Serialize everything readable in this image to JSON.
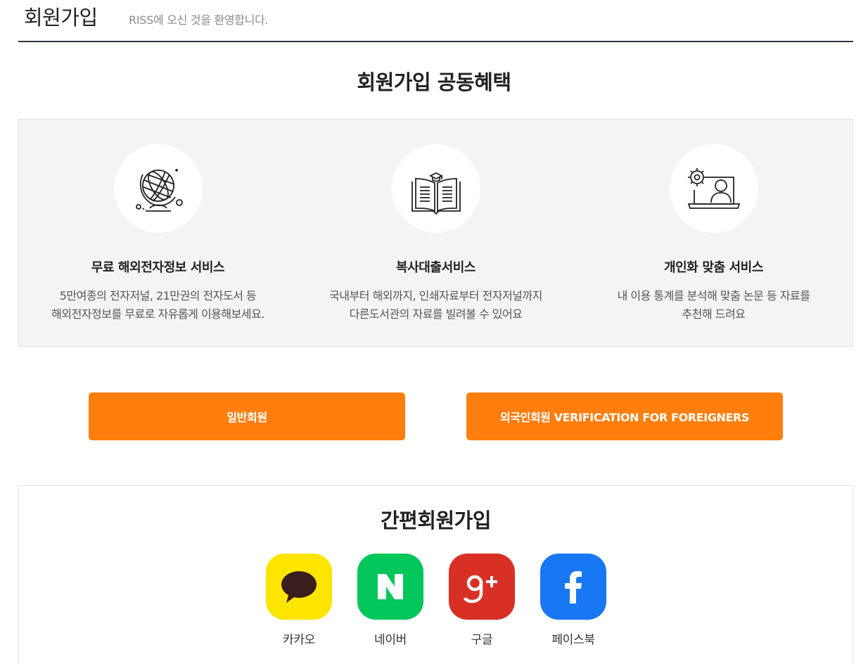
{
  "header": {
    "title": "회원가입",
    "welcome": "RISS에 오신 것을 환영합니다."
  },
  "benefits": {
    "heading": "회원가입 공동혜택",
    "items": [
      {
        "icon": "globe-icon",
        "title": "무료 해외전자정보 서비스",
        "desc_line1": "5만여종의 전자저널, 21만권의 전자도서 등",
        "desc_line2": "해외전자정보를 무료로 자유롭게 이용해보세요."
      },
      {
        "icon": "open-book-icon",
        "title": "복사대출서비스",
        "desc_line1": "국내부터 해외까지, 인쇄자료부터 전자저널까지",
        "desc_line2": "다른도서관의 자료를 빌려볼 수 있어요"
      },
      {
        "icon": "personalized-laptop-icon",
        "title": "개인화 맞춤 서비스",
        "desc_line1": "내 이용 통계를 분석해 맞춤 논문 등 자료를",
        "desc_line2": "추천해 드려요"
      }
    ]
  },
  "buttons": {
    "general": "일반회원",
    "foreigner": "외국인회원 VERIFICATION FOR FOREIGNERS"
  },
  "simple_signup": {
    "title": "간편회원가입",
    "providers": [
      {
        "label": "카카오",
        "icon": "kakao-icon",
        "color": "#fee500"
      },
      {
        "label": "네이버",
        "icon": "naver-icon",
        "color": "#03c75a"
      },
      {
        "label": "구글",
        "icon": "google-plus-icon",
        "color": "#d93025"
      },
      {
        "label": "페이스북",
        "icon": "facebook-icon",
        "color": "#1877f2"
      }
    ]
  },
  "colors": {
    "accent": "#ff7e0e",
    "panel": "#f4f4f4"
  }
}
